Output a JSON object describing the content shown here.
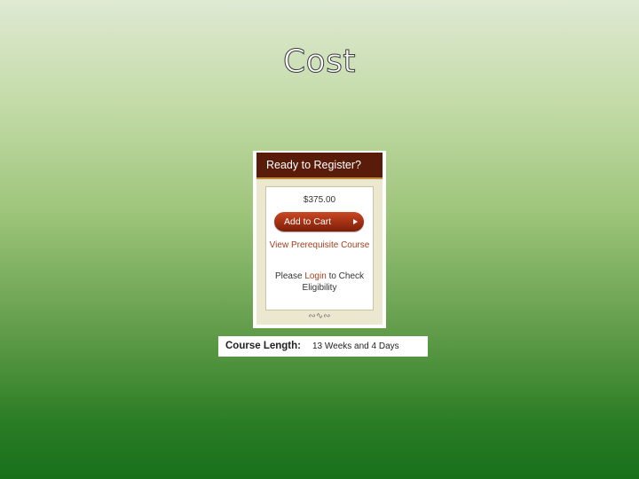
{
  "slide": {
    "title": "Cost"
  },
  "register_widget": {
    "header": "Ready to Register?",
    "price": "$375.00",
    "cart_button_label": "Add to Cart",
    "prereq_link": "View Prerequisite Course",
    "eligibility_prefix": "Please",
    "login_link": "Login",
    "eligibility_suffix": "to Check Eligibility",
    "header_color": "#5a1c0a",
    "button_color": "#a12f12",
    "link_color": "#a3401b",
    "panel_color": "#ece8d0"
  },
  "course_length": {
    "label": "Course Length:",
    "value": "13 Weeks and 4 Days"
  }
}
